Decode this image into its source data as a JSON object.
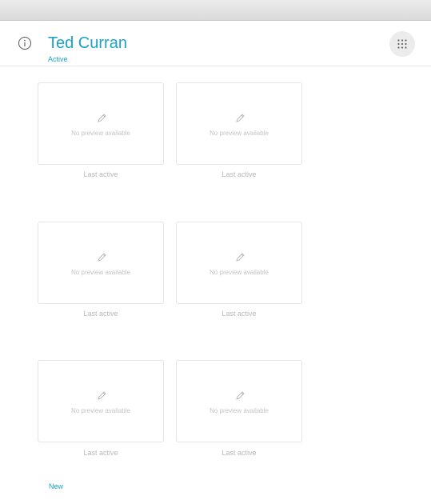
{
  "header": {
    "name": "Ted Curran",
    "status": "Active",
    "info_icon": "info-circle-icon",
    "grid_icon": "dots-grid-icon"
  },
  "colors": {
    "accent": "#1aa3c6",
    "muted_text": "#b9b9b9",
    "tile_border": "#e4e4e4"
  },
  "tiles": [
    {
      "preview_text": "No preview available",
      "caption": "Last active",
      "icon": "pencil-icon"
    },
    {
      "preview_text": "No preview available",
      "caption": "Last active",
      "icon": "pencil-icon"
    },
    {
      "preview_text": "No preview available",
      "caption": "Last active",
      "icon": "pencil-icon"
    },
    {
      "preview_text": "No preview available",
      "caption": "Last active",
      "icon": "pencil-icon"
    },
    {
      "preview_text": "No preview available",
      "caption": "Last active",
      "icon": "pencil-icon"
    },
    {
      "preview_text": "No preview available",
      "caption": "Last active",
      "icon": "pencil-icon"
    }
  ],
  "footer": {
    "new_label": "New"
  }
}
